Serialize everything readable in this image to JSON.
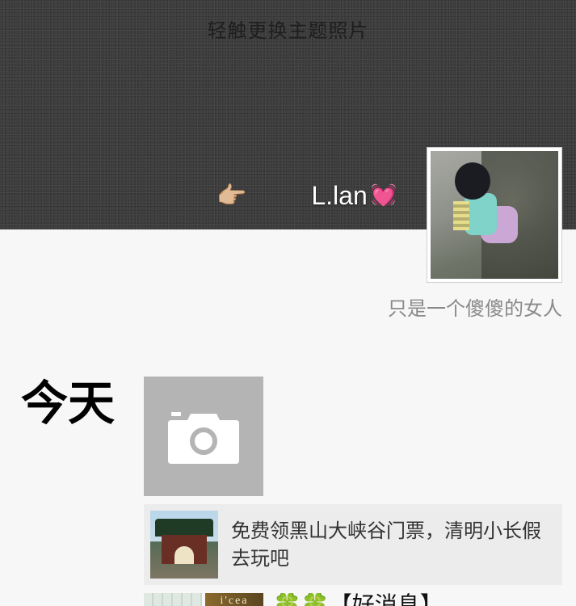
{
  "cover": {
    "hint": "轻触更换主题照片"
  },
  "profile": {
    "hand_emoji": "👉🏼",
    "nickname": "L.lan",
    "heart_emoji": "💓",
    "signature": "只是一个傻傻的女人"
  },
  "timeline": {
    "today_label": "今天",
    "article": {
      "title": "免费领黑山大峡谷门票，清明小长假去玩吧"
    },
    "next_post": {
      "thumb_text": "i'cea",
      "text": "🍀🍀【好消息】"
    }
  },
  "colors": {
    "cover_bg": "#3c3c3c",
    "page_bg": "#f7f7f7",
    "camera_tile": "#b4b4b4",
    "card_bg": "#ececec",
    "signature_text": "#8a8a8a"
  },
  "icons": {
    "camera": "camera-icon",
    "hand": "pointing-hand-icon",
    "heart": "heart-icon"
  }
}
